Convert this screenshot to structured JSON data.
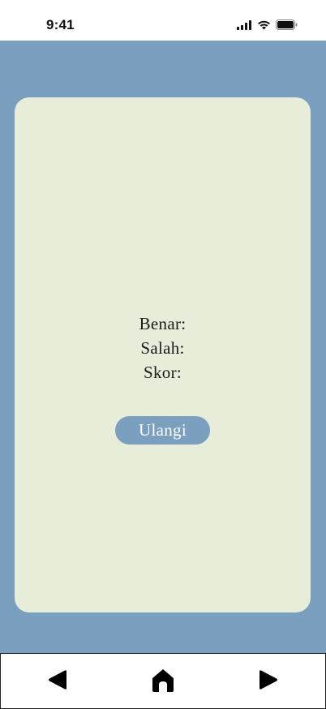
{
  "status_bar": {
    "time": "9:41",
    "icons": [
      "cellular-signal-icon",
      "wifi-icon",
      "battery-icon"
    ]
  },
  "colors": {
    "background": "#7a9fbf",
    "card": "#e8edd9",
    "button": "#7a9fbf",
    "button_text": "#ffffff"
  },
  "result": {
    "correct_label": "Benar:",
    "wrong_label": "Salah:",
    "score_label": "Skor:"
  },
  "retry_button": {
    "label": "Ulangi"
  },
  "bottom_nav": {
    "items": [
      "back-icon",
      "home-icon",
      "forward-icon"
    ]
  }
}
